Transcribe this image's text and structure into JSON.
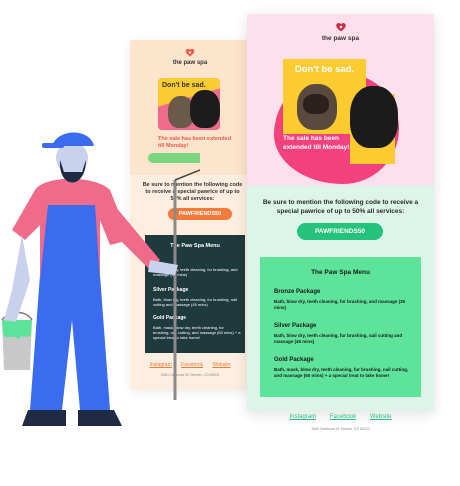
{
  "brand": {
    "name": "the paw spa"
  },
  "email": {
    "headline": "Don't be sad.",
    "subline": "The sale has been extended till Monday!",
    "code_line": "Be sure to mention the following code to receive a special pawrice of up to 50% all services:",
    "promo_code": "PAWFRIENDS50",
    "menu": {
      "title": "The Paw Spa Menu",
      "packages": [
        {
          "name": "Bronze Package",
          "desc": "Bath, blow dry, teeth cleaning, for brushing, and massage (30 mins)"
        },
        {
          "name": "Silver Package",
          "desc": "Bath, blow dry, teeth cleaning, fur brushing, nail cutting and massage (45 mins)"
        },
        {
          "name": "Gold Package",
          "desc": "Bath, mask, blow dry, teeth cleaning, fur brushing, nail cutting, and massage (60 mins) + a special treat to take home!"
        }
      ]
    },
    "links": [
      "Instagram",
      "Facebook",
      "Website"
    ],
    "address": "1560 California St, Denver, CO 80202"
  },
  "back_email_labels": {
    "code_line": "Be sure to mention the following code to receive a special pawrice of up to 50% all services:",
    "silver": "Silver Package",
    "gold": "Gold Package"
  },
  "colors": {
    "front_top": "#fde0ec",
    "front_bottom": "#dcf5e8",
    "front_accent": "#24c27a",
    "pink": "#f2417c",
    "yellow": "#fbcb2f",
    "back_bg": "#fdeedf",
    "back_accent": "#f27a3a",
    "back_menu": "#1f3a3c",
    "painter_overall": "#3b6cf0",
    "painter_shirt": "#f06b8a",
    "paint": "#5de39a"
  },
  "icons": {
    "logo": "heart-paw-icon"
  }
}
